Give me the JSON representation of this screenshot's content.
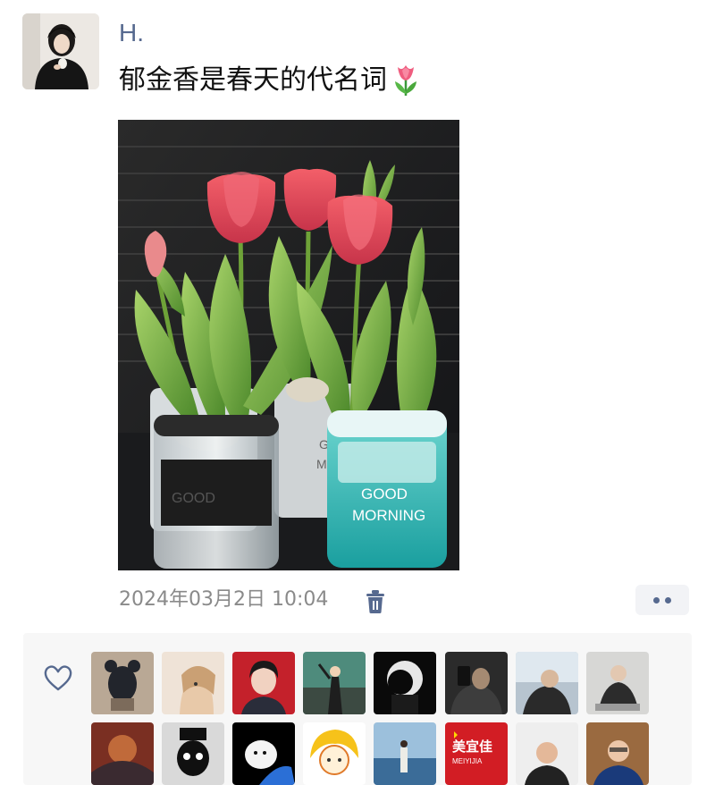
{
  "post": {
    "author": "H.",
    "text": "郁金香是春天的代名词",
    "text_emoji": "tulip-icon",
    "timestamp": "2024年03月2日 10:04",
    "photo": {
      "pots": [
        {
          "label_line1": "GOOD",
          "label_line2": "MORNING",
          "color": "#ffffff"
        },
        {
          "label_line1": "GOOD",
          "label_line2": "MORNING",
          "color": "#2a2a2a"
        },
        {
          "label_line1": "GOOD",
          "label_line2": "MORNING",
          "color": "#ffffff"
        }
      ]
    }
  },
  "actions": {
    "delete_icon": "trash-icon",
    "more_icon": "more-dots-icon",
    "like_icon": "heart-icon"
  },
  "likes": {
    "row1": [
      "liker-1",
      "liker-2",
      "liker-3",
      "liker-4",
      "liker-5",
      "liker-6",
      "liker-7",
      "liker-8"
    ],
    "row2": [
      "liker-9",
      "liker-10",
      "liker-11",
      "liker-12",
      "liker-13",
      "liker-14",
      "liker-15",
      "liker-16"
    ],
    "liker_15_text_1": "美宜佳",
    "liker_15_text_2": "MEIYIJIA"
  },
  "colors": {
    "author": "#56698f",
    "timestamp": "#8a8a8a",
    "accent_blue": "#56698f"
  }
}
